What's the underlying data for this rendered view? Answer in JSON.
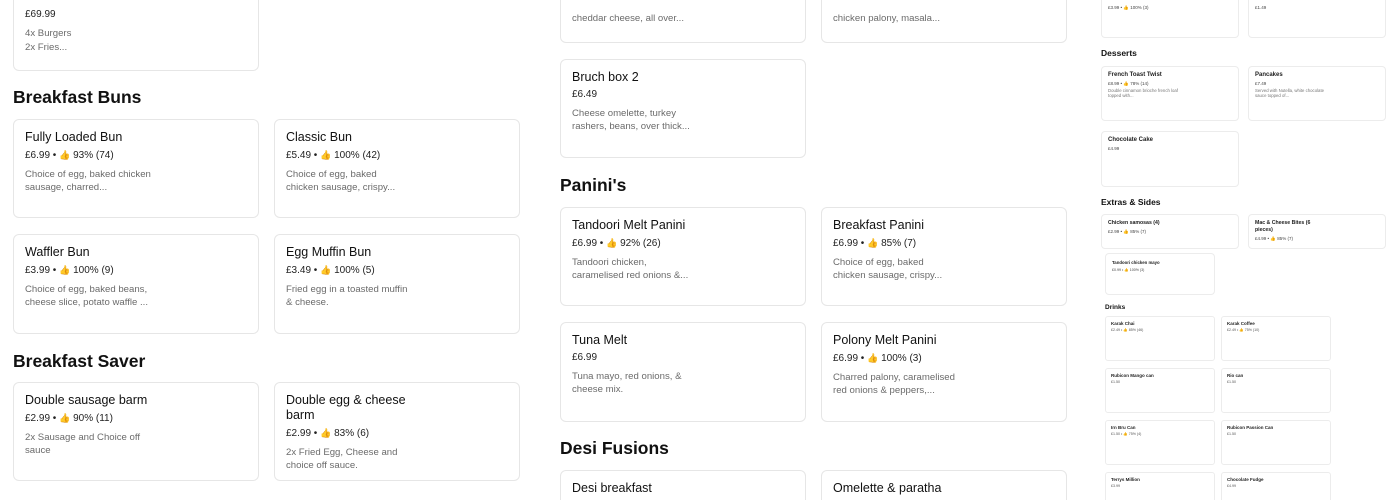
{
  "top_partial": {
    "price": "£69.99",
    "desc_line1": "4x Burgers",
    "desc_line2": "2x Fries..."
  },
  "col2_top": {
    "card1_desc": "cheddar cheese, all over...",
    "card2_desc": "chicken palony, masala..."
  },
  "bruch_box": {
    "name": "Bruch box 2",
    "price": "£6.49",
    "desc": "Cheese omelette, turkey rashers, beans, over thick..."
  },
  "sections": {
    "breakfast_buns": "Breakfast Buns",
    "breakfast_saver": "Breakfast Saver",
    "paninis": "Panini's",
    "desi_fusions": "Desi Fusions"
  },
  "breakfast_buns": [
    {
      "name": "Fully Loaded Bun",
      "price": "£6.99",
      "rating": "93% (74)",
      "desc": "Choice of egg, baked chicken sausage, charred..."
    },
    {
      "name": "Classic Bun",
      "price": "£5.49",
      "rating": "100% (42)",
      "desc": "Choice of egg, baked chicken sausage, crispy..."
    },
    {
      "name": "Waffler Bun",
      "price": "£3.99",
      "rating": "100% (9)",
      "desc": "Choice of egg, baked beans, cheese slice, potato waffle ..."
    },
    {
      "name": "Egg Muffin Bun",
      "price": "£3.49",
      "rating": "100% (5)",
      "desc": "Fried egg in a toasted muffin & cheese."
    }
  ],
  "breakfast_saver": [
    {
      "name": "Double sausage barm",
      "price": "£2.99",
      "rating": "90% (11)",
      "desc": "2x Sausage and Choice off sauce"
    },
    {
      "name": "Double egg & cheese barm",
      "price": "£2.99",
      "rating": "83% (6)",
      "desc": "2x Fried Egg, Cheese and choice off sauce."
    }
  ],
  "paninis": [
    {
      "name": "Tandoori Melt Panini",
      "price": "£6.99",
      "rating": "92% (26)",
      "desc": "Tandoori chicken, caramelised red onions &..."
    },
    {
      "name": "Breakfast Panini",
      "price": "£6.99",
      "rating": "85% (7)",
      "desc": "Choice of egg, baked chicken sausage, crispy..."
    },
    {
      "name": "Tuna Melt",
      "price": "£6.99",
      "rating": "",
      "desc": "Tuna mayo, red onions, & cheese mix."
    },
    {
      "name": "Polony Melt Panini",
      "price": "£6.99",
      "rating": "100% (3)",
      "desc": "Charred palony, caramelised red onions & peppers,..."
    }
  ],
  "desi_fusions": [
    {
      "name": "Desi breakfast"
    },
    {
      "name": "Omelette & paratha"
    }
  ],
  "side_panel": {
    "top_row": [
      {
        "meta": "£3.99 • 👍 100% (3)"
      },
      {
        "meta": "£1.49"
      }
    ],
    "desserts_title": "Desserts",
    "desserts": [
      {
        "name": "French Toast Twist",
        "meta": "£8.99 • 👍 78% (14)",
        "desc": "Double cinnamon brioche french loaf topped with..."
      },
      {
        "name": "Pancakes",
        "meta": "£7.49",
        "desc": "Served with Nutella, white chocolate sauce topped of..."
      },
      {
        "name": "Chocolate Cake",
        "meta": "£4.99",
        "desc": ""
      }
    ],
    "extras_title": "Extras & Sides",
    "extras": [
      {
        "name": "Chicken samosas (4)",
        "meta": "£2.99 • 👍 85% (7)"
      },
      {
        "name": "Mac & Cheese Bites (6 pieces)",
        "meta": "£4.99 • 👍 85% (7)"
      },
      {
        "name": "Tandoori chicken mayo",
        "meta": "£0.99 • 👍 100% (3)"
      }
    ],
    "drinks_title": "Drinks",
    "drinks": [
      {
        "name": "Karak Chai",
        "meta": "£2.49 • 👍 85% (46)"
      },
      {
        "name": "Karak Coffee",
        "meta": "£2.49 • 👍 75% (10)"
      },
      {
        "name": "Rubicon Mango can",
        "meta": "£1.50"
      },
      {
        "name": "Rio can",
        "meta": "£1.50"
      },
      {
        "name": "Irn Bru Can",
        "meta": "£1.50 • 👍 75% (4)"
      },
      {
        "name": "Rubicon Passion Can",
        "meta": "£1.50"
      },
      {
        "name": "Terrys Million",
        "meta": "£3.99"
      },
      {
        "name": "Chocolate Fudge",
        "meta": "£4.99"
      }
    ]
  },
  "colors": {
    "border": "#e6e6e6",
    "text": "#111111",
    "muted": "#6b6b6b"
  },
  "icons": {
    "rating": "thumbs-up-icon"
  }
}
